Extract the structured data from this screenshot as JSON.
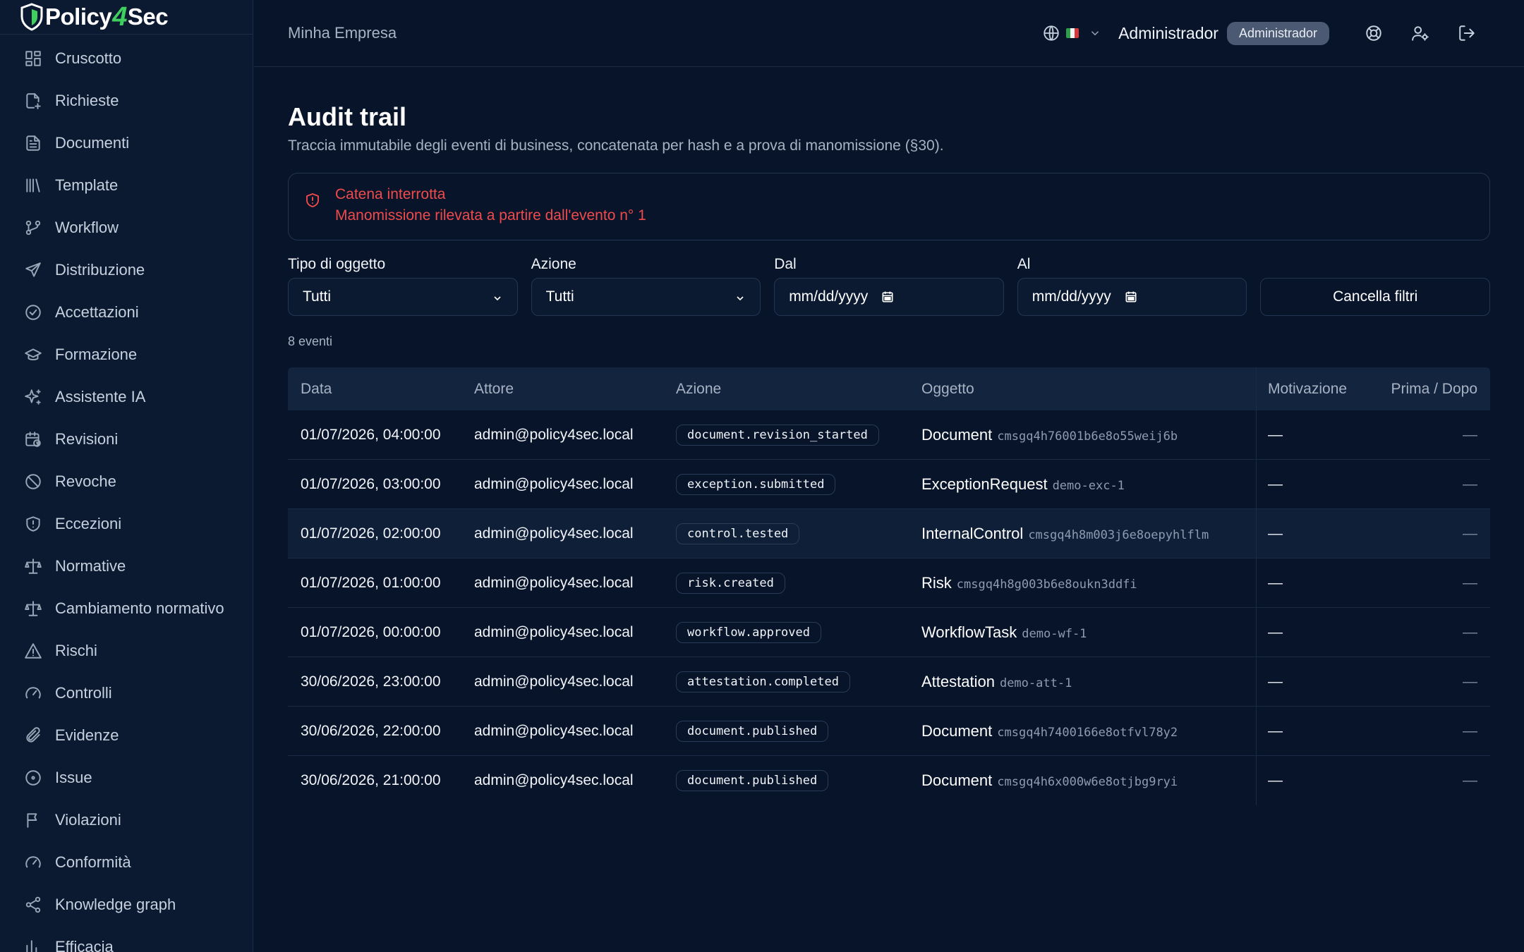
{
  "brand": {
    "name_left": "Policy",
    "name_mid": "4",
    "name_right": "Sec"
  },
  "sidebar": {
    "items": [
      {
        "label": "Cruscotto",
        "icon": "dashboard-icon"
      },
      {
        "label": "Richieste",
        "icon": "file-plus-icon"
      },
      {
        "label": "Documenti",
        "icon": "document-icon"
      },
      {
        "label": "Template",
        "icon": "library-icon"
      },
      {
        "label": "Workflow",
        "icon": "git-branch-icon"
      },
      {
        "label": "Distribuzione",
        "icon": "send-icon"
      },
      {
        "label": "Accettazioni",
        "icon": "check-circle-icon"
      },
      {
        "label": "Formazione",
        "icon": "graduation-cap-icon"
      },
      {
        "label": "Assistente IA",
        "icon": "sparkles-icon"
      },
      {
        "label": "Revisioni",
        "icon": "calendar-clock-icon"
      },
      {
        "label": "Revoche",
        "icon": "ban-icon"
      },
      {
        "label": "Eccezioni",
        "icon": "shield-alert-icon"
      },
      {
        "label": "Normative",
        "icon": "scale-icon"
      },
      {
        "label": "Cambiamento normativo",
        "icon": "scale-icon"
      },
      {
        "label": "Rischi",
        "icon": "warning-icon"
      },
      {
        "label": "Controlli",
        "icon": "gauge-icon"
      },
      {
        "label": "Evidenze",
        "icon": "paperclip-icon"
      },
      {
        "label": "Issue",
        "icon": "circle-dot-icon"
      },
      {
        "label": "Violazioni",
        "icon": "flag-icon"
      },
      {
        "label": "Conformità",
        "icon": "gauge-icon"
      },
      {
        "label": "Knowledge graph",
        "icon": "share-icon"
      },
      {
        "label": "Efficacia",
        "icon": "chart-icon"
      }
    ]
  },
  "topbar": {
    "org": "Minha Empresa",
    "user": "Administrador",
    "role": "Administrador"
  },
  "page": {
    "title": "Audit trail",
    "subtitle": "Traccia immutabile degli eventi di business, concatenata per hash e a prova di manomissione (§30)."
  },
  "alert": {
    "title": "Catena interrotta",
    "desc": "Manomissione rilevata a partire dall'evento n° 1"
  },
  "filters": {
    "type_label": "Tipo di oggetto",
    "type_value": "Tutti",
    "action_label": "Azione",
    "action_value": "Tutti",
    "from_label": "Dal",
    "from_placeholder": "mm/dd/yyyy",
    "to_label": "Al",
    "to_placeholder": "mm/dd/yyyy",
    "clear_label": "Cancella filtri"
  },
  "count_label": "8 eventi",
  "table": {
    "headers": {
      "date": "Data",
      "actor": "Attore",
      "action": "Azione",
      "object": "Oggetto",
      "reason": "Motivazione",
      "before_after": "Prima / Dopo"
    },
    "rows": [
      {
        "date": "01/07/2026, 04:00:00",
        "actor": "admin@policy4sec.local",
        "action": "document.revision_started",
        "obj_type": "Document",
        "obj_id": "cmsgq4h76001b6e8o55weij6b",
        "reason": "—",
        "before_after": "—"
      },
      {
        "date": "01/07/2026, 03:00:00",
        "actor": "admin@policy4sec.local",
        "action": "exception.submitted",
        "obj_type": "ExceptionRequest",
        "obj_id": "demo-exc-1",
        "reason": "—",
        "before_after": "—"
      },
      {
        "date": "01/07/2026, 02:00:00",
        "actor": "admin@policy4sec.local",
        "action": "control.tested",
        "obj_type": "InternalControl",
        "obj_id": "cmsgq4h8m003j6e8oepyhlflm",
        "reason": "—",
        "before_after": "—"
      },
      {
        "date": "01/07/2026, 01:00:00",
        "actor": "admin@policy4sec.local",
        "action": "risk.created",
        "obj_type": "Risk",
        "obj_id": "cmsgq4h8g003b6e8oukn3ddfi",
        "reason": "—",
        "before_after": "—"
      },
      {
        "date": "01/07/2026, 00:00:00",
        "actor": "admin@policy4sec.local",
        "action": "workflow.approved",
        "obj_type": "WorkflowTask",
        "obj_id": "demo-wf-1",
        "reason": "—",
        "before_after": "—"
      },
      {
        "date": "30/06/2026, 23:00:00",
        "actor": "admin@policy4sec.local",
        "action": "attestation.completed",
        "obj_type": "Attestation",
        "obj_id": "demo-att-1",
        "reason": "—",
        "before_after": "—"
      },
      {
        "date": "30/06/2026, 22:00:00",
        "actor": "admin@policy4sec.local",
        "action": "document.published",
        "obj_type": "Document",
        "obj_id": "cmsgq4h7400166e8otfvl78y2",
        "reason": "—",
        "before_after": "—"
      },
      {
        "date": "30/06/2026, 21:00:00",
        "actor": "admin@policy4sec.local",
        "action": "document.published",
        "obj_type": "Document",
        "obj_id": "cmsgq4h6x000w6e8otjbg9ryi",
        "reason": "—",
        "before_after": "—"
      }
    ]
  }
}
